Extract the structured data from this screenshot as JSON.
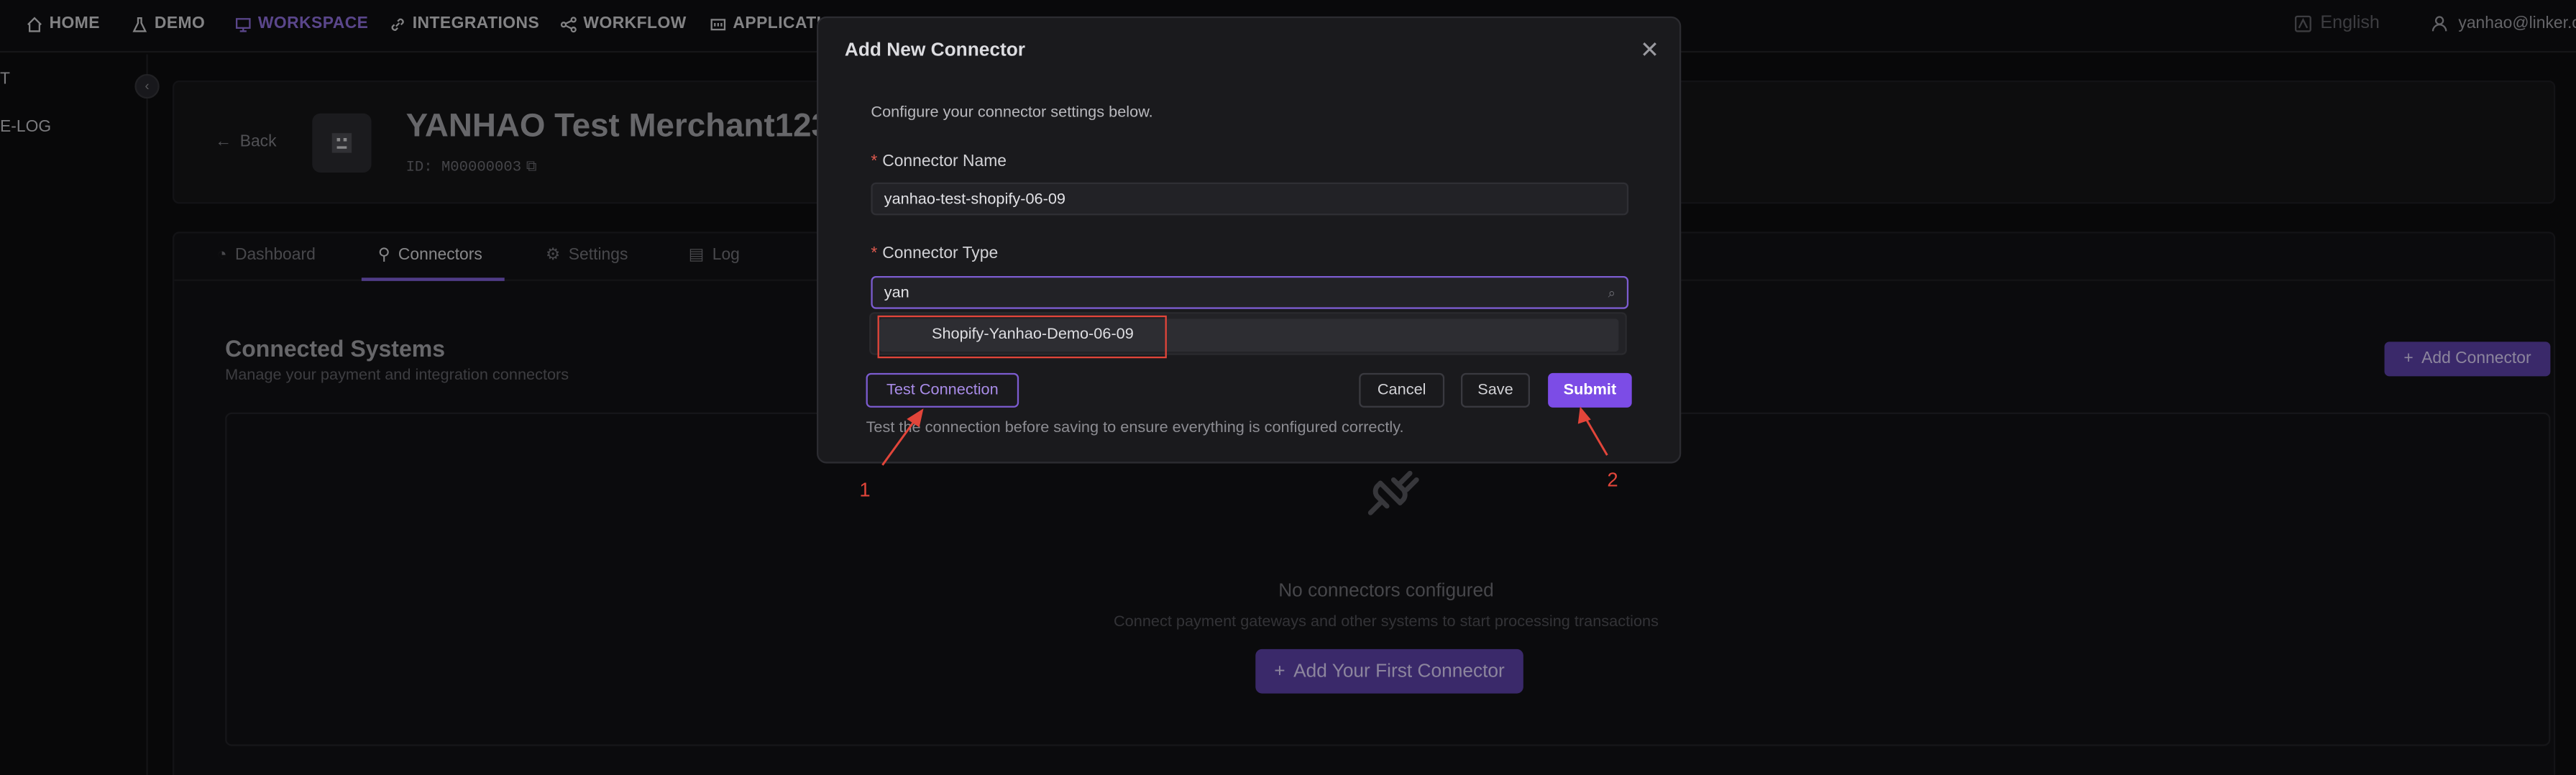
{
  "nav": {
    "items": [
      {
        "label": "HOME",
        "icon": "home-icon"
      },
      {
        "label": "DEMO",
        "icon": "flask-icon"
      },
      {
        "label": "WORKSPACE",
        "icon": "monitor-icon"
      },
      {
        "label": "INTEGRATIONS",
        "icon": "link-icon"
      },
      {
        "label": "WORKFLOW",
        "icon": "workflow-icon"
      },
      {
        "label": "APPLICATIO",
        "icon": "app-icon"
      }
    ],
    "language": "English",
    "user": "yanhao@linker.c"
  },
  "sidebar": {
    "items": [
      {
        "label": "T"
      },
      {
        "label": "E-LOG"
      }
    ]
  },
  "merchant": {
    "back_label": "Back",
    "name": "YANHAO Test Merchant123",
    "id": "ID: M00000003"
  },
  "tabs": [
    {
      "label": "Dashboard",
      "icon": "dashboard-icon"
    },
    {
      "label": "Connectors",
      "icon": "link-icon"
    },
    {
      "label": "Settings",
      "icon": "gear-icon"
    },
    {
      "label": "Log",
      "icon": "file-icon"
    }
  ],
  "connected": {
    "title": "Connected Systems",
    "subtitle": "Manage your payment and integration connectors",
    "add_button": "Add Connector",
    "empty_title": "No connectors configured",
    "empty_subtitle": "Connect payment gateways and other systems to start processing transactions",
    "add_first_button": "Add Your First Connector"
  },
  "modal": {
    "title": "Add New Connector",
    "description": "Configure your connector settings below.",
    "name_label": "Connector Name",
    "name_value": "yanhao-test-shopify-06-09",
    "type_label": "Connector Type",
    "type_value": "yan",
    "option": "Shopify-Yanhao-Demo-06-09",
    "test_button": "Test Connection",
    "cancel_button": "Cancel",
    "save_button": "Save",
    "submit_button": "Submit",
    "hint": "Test the connection before saving to ensure everything is configured correctly."
  },
  "annotations": {
    "one": "1",
    "two": "2",
    "color": "#e2453a"
  },
  "colors": {
    "accent": "#7c4ce6",
    "background": "#0d0d0f"
  }
}
